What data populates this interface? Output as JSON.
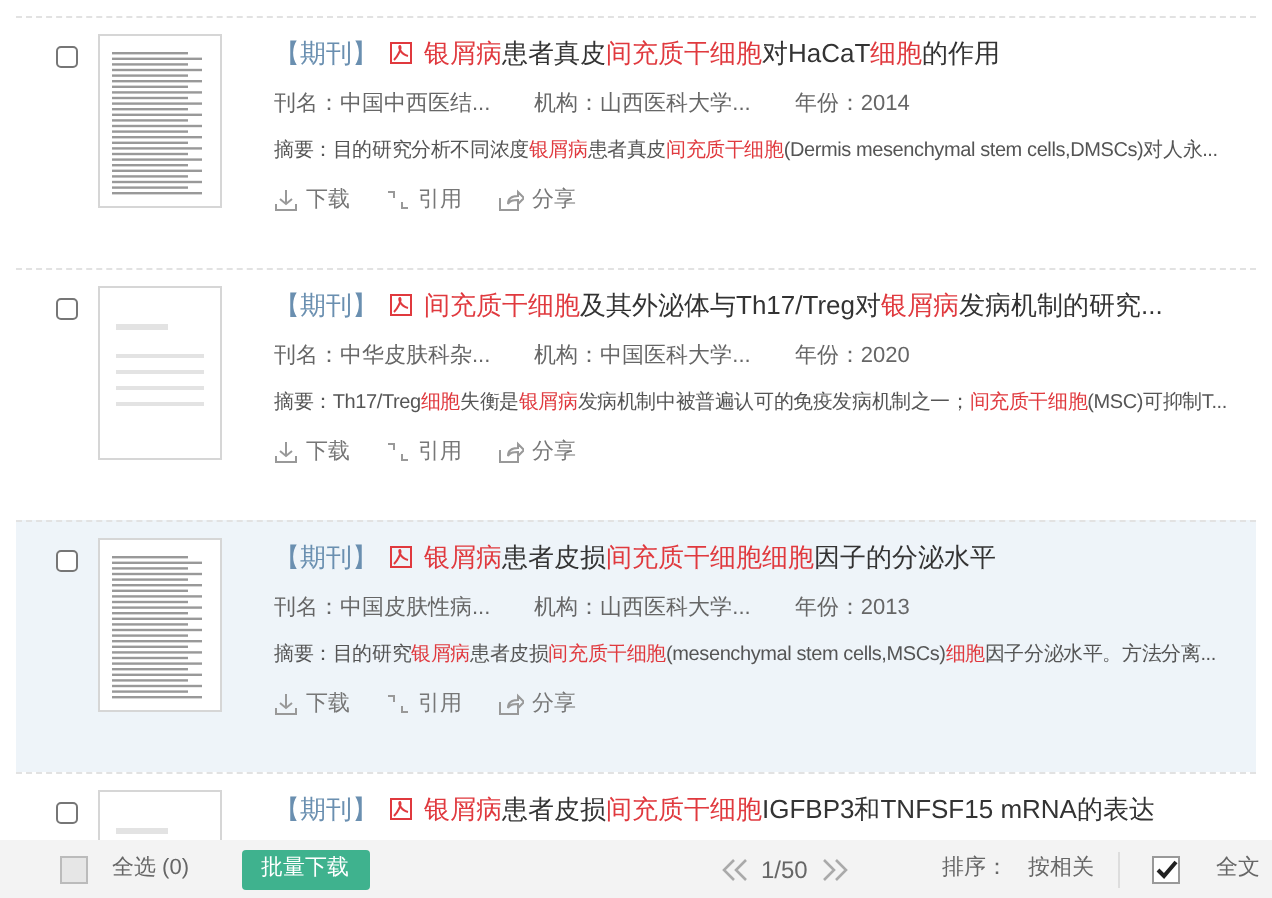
{
  "results": [
    {
      "selected": false,
      "kind": "scan",
      "tag": "【期刊】",
      "title": [
        {
          "text": "银屑病",
          "hl": true
        },
        {
          "text": "患者真皮",
          "hl": false
        },
        {
          "text": "间充质干细胞",
          "hl": true
        },
        {
          "text": "对HaCaT",
          "hl": false
        },
        {
          "text": "细胞",
          "hl": true
        },
        {
          "text": "的作用",
          "hl": false
        }
      ],
      "meta": [
        "刊名：中国中西医结...",
        "机构：山西医科大学...",
        "年份：2014"
      ],
      "abstract": [
        {
          "text": "摘要：目的研究分析不同浓度",
          "hl": false
        },
        {
          "text": "银屑病",
          "hl": true
        },
        {
          "text": "患者真皮",
          "hl": false
        },
        {
          "text": "间充质干细胞",
          "hl": true
        },
        {
          "text": "(Dermis mesenchymal stem cells,DMSCs)对人永...",
          "hl": false
        }
      ],
      "actions": [
        "下载",
        "引用",
        "分享"
      ],
      "hovered": false
    },
    {
      "selected": false,
      "kind": "blank",
      "tag": "【期刊】",
      "title": [
        {
          "text": "间充质干细胞",
          "hl": true
        },
        {
          "text": "及其外泌体与Th17/Treg对",
          "hl": false
        },
        {
          "text": "银屑病",
          "hl": true
        },
        {
          "text": "发病机制的研究...",
          "hl": false
        }
      ],
      "meta": [
        "刊名：中华皮肤科杂...",
        "机构：中国医科大学...",
        "年份：2020"
      ],
      "abstract": [
        {
          "text": "摘要：Th17/Treg",
          "hl": false
        },
        {
          "text": "细胞",
          "hl": true
        },
        {
          "text": "失衡是",
          "hl": false
        },
        {
          "text": "银屑病",
          "hl": true
        },
        {
          "text": "发病机制中被普遍认可的免疫发病机制之一；",
          "hl": false
        },
        {
          "text": "间充质干细胞",
          "hl": true
        },
        {
          "text": "(MSC)可抑制T...",
          "hl": false
        }
      ],
      "actions": [
        "下载",
        "引用",
        "分享"
      ],
      "hovered": false
    },
    {
      "selected": false,
      "kind": "scan",
      "tag": "【期刊】",
      "title": [
        {
          "text": "银屑病",
          "hl": true
        },
        {
          "text": "患者皮损",
          "hl": false
        },
        {
          "text": "间充质干细胞细胞",
          "hl": true
        },
        {
          "text": "因子的分泌水平",
          "hl": false
        }
      ],
      "meta": [
        "刊名：中国皮肤性病...",
        "机构：山西医科大学...",
        "年份：2013"
      ],
      "abstract": [
        {
          "text": "摘要：目的研究",
          "hl": false
        },
        {
          "text": "银屑病",
          "hl": true
        },
        {
          "text": "患者皮损",
          "hl": false
        },
        {
          "text": "间充质干细胞",
          "hl": true
        },
        {
          "text": "(mesenchymal stem cells,MSCs)",
          "hl": false
        },
        {
          "text": "细胞",
          "hl": true
        },
        {
          "text": "因子分泌水平。方法分离...",
          "hl": false
        }
      ],
      "actions": [
        "下载",
        "引用",
        "分享"
      ],
      "hovered": true
    },
    {
      "selected": false,
      "kind": "blank",
      "tag": "【期刊】",
      "title": [
        {
          "text": "银屑病",
          "hl": true
        },
        {
          "text": "患者皮损",
          "hl": false
        },
        {
          "text": "间充质干细胞",
          "hl": true
        },
        {
          "text": "IGFBP3和TNFSF15 mRNA的表达",
          "hl": false
        }
      ],
      "hovered": false
    }
  ],
  "footer": {
    "select_all": {
      "label": "全选 (0)",
      "checked": false
    },
    "batch_download": "批量下载",
    "pager": "1/50",
    "sort_label": "排序：",
    "sort_value": "按相关",
    "fulltext": {
      "label": "全文",
      "checked": true
    }
  }
}
